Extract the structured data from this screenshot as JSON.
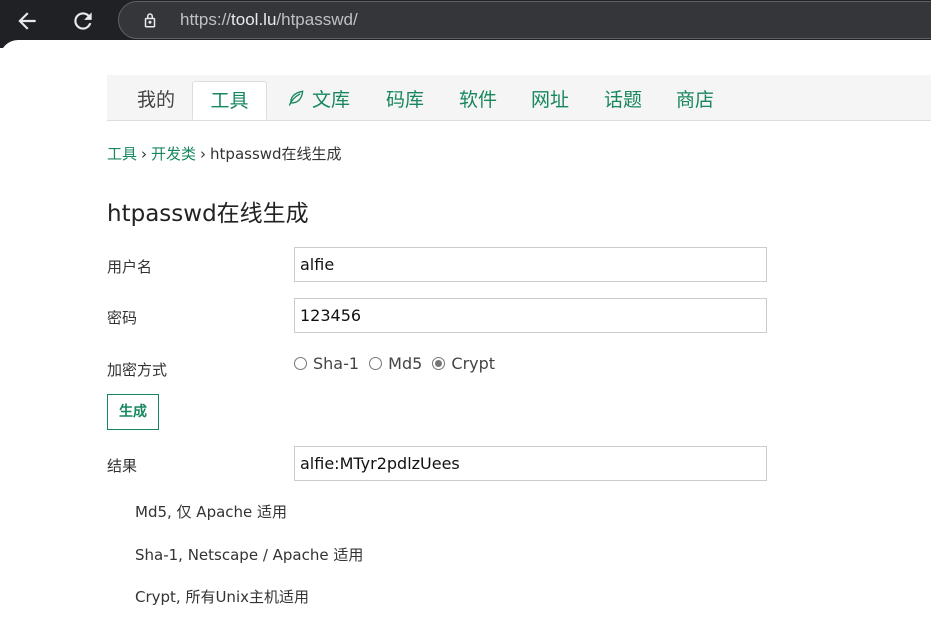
{
  "browser": {
    "url_scheme": "https://",
    "url_host": "tool.lu",
    "url_path": "/htpasswd/",
    "icons": [
      "back-arrow-icon",
      "reload-icon",
      "lock-icon"
    ]
  },
  "nav": {
    "items": [
      {
        "label": "我的"
      },
      {
        "label": "工具"
      },
      {
        "label": "文库"
      },
      {
        "label": "码库"
      },
      {
        "label": "软件"
      },
      {
        "label": "网址"
      },
      {
        "label": "话题"
      },
      {
        "label": "商店"
      }
    ],
    "active": "工具",
    "accent_color": "#17875d"
  },
  "breadcrumb": {
    "items": [
      "工具",
      "开发类",
      "htpasswd在线生成"
    ],
    "separator": "›"
  },
  "page_title": "htpasswd在线生成",
  "form": {
    "username_label": "用户名",
    "username_value": "alfie",
    "password_label": "密码",
    "password_value": "123456",
    "method_label": "加密方式",
    "methods": [
      {
        "label": "Sha-1",
        "checked": false
      },
      {
        "label": "Md5",
        "checked": false
      },
      {
        "label": "Crypt",
        "checked": true
      }
    ],
    "generate_label": "生成",
    "result_label": "结果",
    "result_value": "alfie:MTyr2pdlzUees"
  },
  "notes": [
    "Md5, 仅 Apache 适用",
    "Sha-1, Netscape / Apache 适用",
    "Crypt, 所有Unix主机适用"
  ]
}
